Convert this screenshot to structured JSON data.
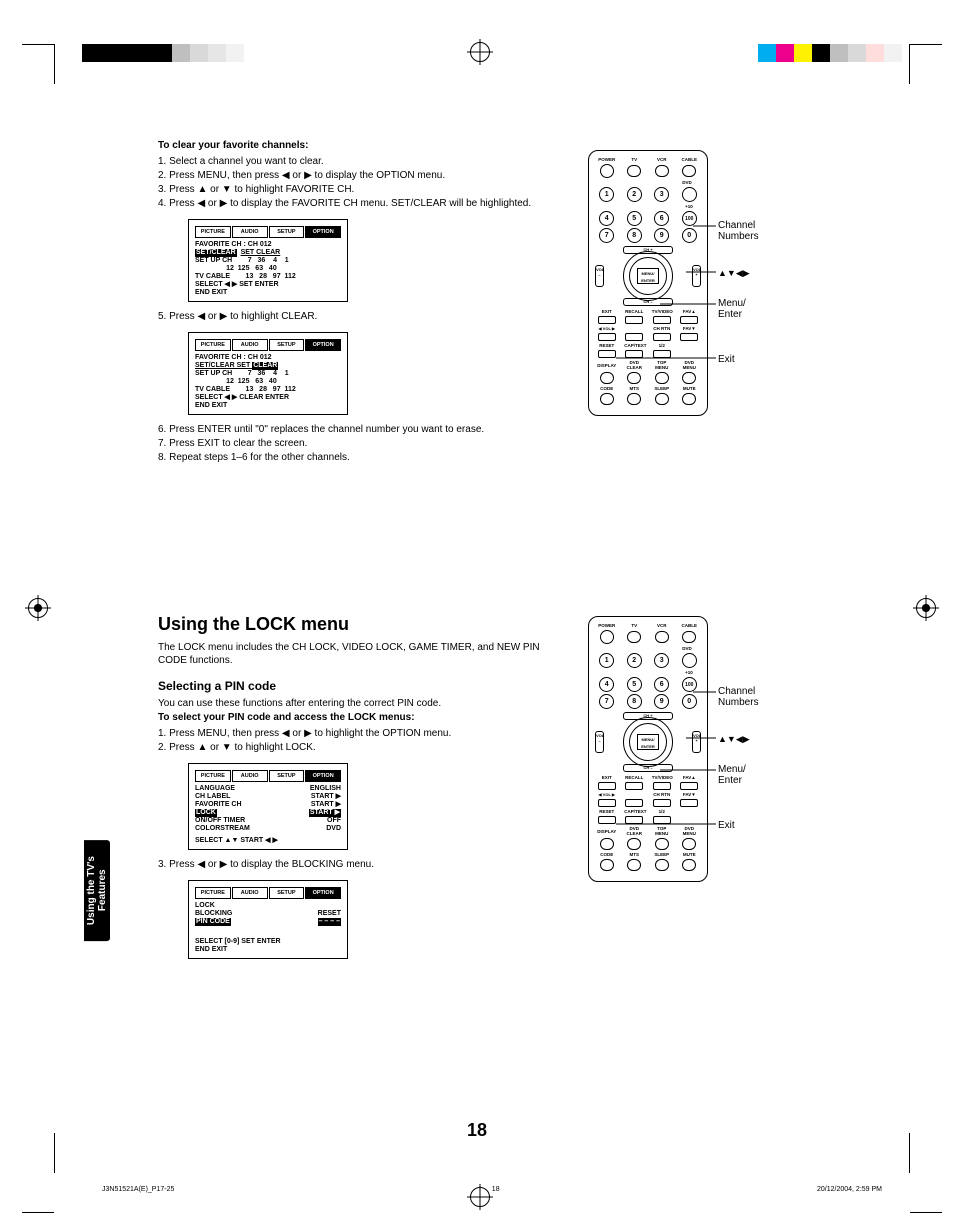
{
  "registration": {
    "left_colors": [
      "#000",
      "#000",
      "#000",
      "#000",
      "#000",
      "#bfbfbf",
      "#d9d9d9",
      "#e6e6e6",
      "#f2f2f2"
    ],
    "right_colors": [
      "#00aeef",
      "#ec008c",
      "#fff200",
      "#000",
      "#bfbfbf",
      "#d9d9d9",
      "#e6e6e6",
      "#f2f2f2"
    ]
  },
  "page_number": "18",
  "footer": {
    "left": "J3N51521A(E)_P17-25",
    "center": "18",
    "right": "20/12/2004, 2:59 PM"
  },
  "sidetab": "Using the TV's\nFeatures",
  "clear_section": {
    "heading": "To clear your favorite channels:",
    "steps": [
      "1. Select a channel you want to clear.",
      "2. Press MENU, then press ◀ or ▶ to display the OPTION menu.",
      "3. Press ▲ or ▼ to highlight FAVORITE CH.",
      "4. Press ◀ or ▶ to display the FAVORITE CH menu. SET/CLEAR will be highlighted.",
      "5. Press ◀ or ▶ to highlight CLEAR.",
      "6. Press ENTER until \"0\" replaces the channel number you want to erase.",
      "7. Press EXIT to clear the screen.",
      "8. Repeat steps 1–6 for the other channels."
    ]
  },
  "osd1": {
    "tabs": [
      "PICTURE",
      "AUDIO",
      "SETUP",
      "OPTION"
    ],
    "active_tab": 3,
    "title": "FAVORITE CH : CH 012",
    "highlight": "SET/CLEAR",
    "line1_rest": "SET CLEAR",
    "rows": [
      "SET UP CH        7   36    4    1",
      "                12  125   63   40",
      "TV CABLE        13   28   97  112"
    ],
    "hint": "SELECT  ◀ ▶   SET       ENTER",
    "hint2": "END        EXIT"
  },
  "osd2": {
    "tabs": [
      "PICTURE",
      "AUDIO",
      "SETUP",
      "OPTION"
    ],
    "active_tab": 3,
    "title": "FAVORITE CH : CH 012",
    "line1_pre": "SET/CLEAR     SET ",
    "highlight": "CLEAR",
    "rows": [
      "SET UP CH        7   36    4    1",
      "                12  125   63   40",
      "TV CABLE        13   28   97  112"
    ],
    "hint": "SELECT  ◀ ▶   CLEAR    ENTER",
    "hint2": "END        EXIT"
  },
  "lock_section": {
    "heading": "Using the LOCK menu",
    "intro": "The LOCK menu includes the CH LOCK, VIDEO LOCK, GAME TIMER, and NEW PIN CODE functions.",
    "sub": "Selecting a PIN code",
    "sub_intro": "You can use these functions after entering the correct PIN code.",
    "bold": "To select your PIN code and access the LOCK menus:",
    "steps_a": [
      "1. Press MENU, then press ◀ or ▶ to highlight the OPTION menu.",
      "2. Press ▲ or ▼ to highlight LOCK."
    ],
    "step_b": "3. Press ◀ or ▶ to display the BLOCKING menu."
  },
  "osd3": {
    "tabs": [
      "PICTURE",
      "AUDIO",
      "SETUP",
      "OPTION"
    ],
    "active_tab": 3,
    "rows": [
      [
        "LANGUAGE",
        "ENGLISH"
      ],
      [
        "CH LABEL",
        "START ▶"
      ],
      [
        "FAVORITE CH",
        "START ▶"
      ]
    ],
    "highlight_row": [
      "LOCK",
      "START ▶"
    ],
    "rows2": [
      [
        "ON/OFF TIMER",
        "OFF"
      ],
      [
        "COLORSTREAM",
        "DVD"
      ]
    ],
    "hint": "SELECT   ▲▼      START     ◀ ▶"
  },
  "osd4": {
    "tabs": [
      "PICTURE",
      "AUDIO",
      "SETUP",
      "OPTION"
    ],
    "active_tab": 3,
    "rows": [
      [
        "LOCK",
        ""
      ],
      [
        "BLOCKING",
        "RESET"
      ]
    ],
    "highlight_row": [
      "PIN CODE",
      "– – – –"
    ],
    "hint": "SELECT   [0-9]   SET         ENTER",
    "hint2": "END        EXIT"
  },
  "remote": {
    "top_labels": [
      "POWER",
      "TV",
      "VCR",
      "CABLE"
    ],
    "dvd_label": "DVD",
    "numbers": [
      "1",
      "2",
      "3",
      "4",
      "5",
      "6",
      "7",
      "8",
      "9",
      "0"
    ],
    "plus10": "+10",
    "hundred": "100",
    "center": "MENU/\nENTER",
    "vol": "VOL",
    "ch_plus": "CH +",
    "ch_minus": "CH –",
    "mid_labels_r1": [
      "EXIT",
      "RECALL",
      "TV/VIDEO",
      "FAV▲"
    ],
    "mid_labels_r2": [
      "◀ VOL ▶",
      "",
      "CH RTN",
      "FAV▼"
    ],
    "mid_labels_r3": [
      "RESET",
      "CAP/TEXT",
      "1/2",
      ""
    ],
    "mid_labels_r4": [
      "DISPLAY",
      "DVD CLEAR",
      "TOP MENU",
      "DVD MENU"
    ],
    "bottom_labels": [
      "CODE",
      "MTS",
      "SLEEP",
      "MUTE"
    ],
    "callouts": {
      "channel": "Channel\nNumbers",
      "arrows": "▲▼◀▶",
      "menu": "Menu/\nEnter",
      "exit": "Exit"
    }
  }
}
